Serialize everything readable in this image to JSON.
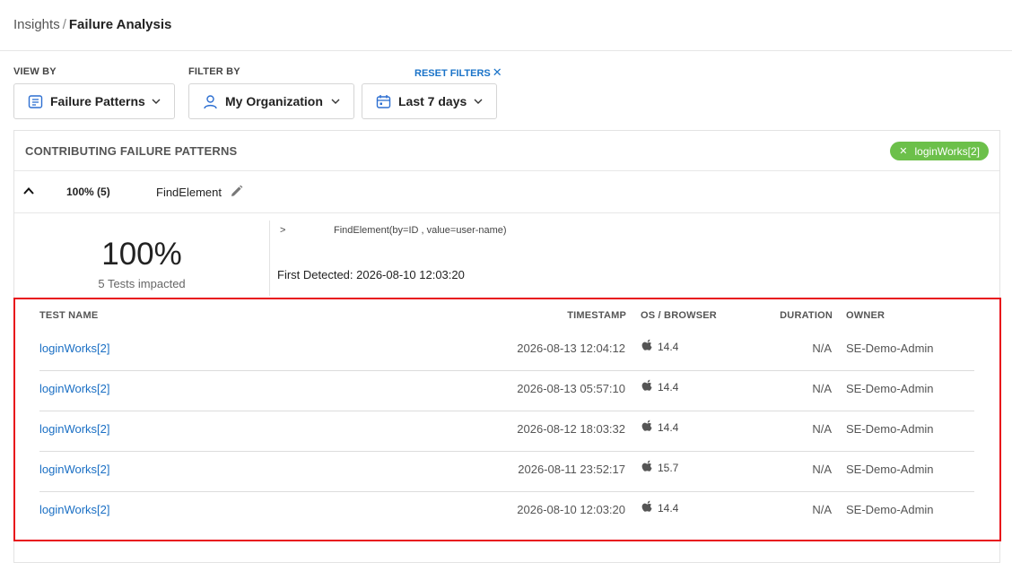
{
  "breadcrumb": {
    "parent": "Insights",
    "separator": "/",
    "current": "Failure Analysis"
  },
  "filters": {
    "view_by_label": "VIEW BY",
    "filter_by_label": "FILTER BY",
    "reset_label": "RESET FILTERS",
    "reset_icon": "close-icon",
    "view_by_value": "Failure Patterns",
    "organization_value": "My Organization",
    "date_range_value": "Last 7 days"
  },
  "panel": {
    "title": "CONTRIBUTING FAILURE PATTERNS",
    "chip_label": "loginWorks[2]",
    "chip_color": "#6cc04a"
  },
  "pattern": {
    "percent_count": "100% (5)",
    "name": "FindElement",
    "percent": "100%",
    "impacted": "5 Tests impacted",
    "prompt": ">",
    "signature": "FindElement(by=ID , value=user-name)",
    "first_detected": "First Detected: 2026-08-10 12:03:20"
  },
  "table": {
    "headers": {
      "test_name": "TEST NAME",
      "timestamp": "TIMESTAMP",
      "os_browser": "OS / BROWSER",
      "duration": "DURATION",
      "owner": "OWNER"
    },
    "rows": [
      {
        "name": "loginWorks[2]",
        "timestamp": "2026-08-13 12:04:12",
        "os_icon": "apple-icon",
        "os_version": "14.4",
        "duration": "N/A",
        "owner": "SE-Demo-Admin"
      },
      {
        "name": "loginWorks[2]",
        "timestamp": "2026-08-13 05:57:10",
        "os_icon": "apple-icon",
        "os_version": "14.4",
        "duration": "N/A",
        "owner": "SE-Demo-Admin"
      },
      {
        "name": "loginWorks[2]",
        "timestamp": "2026-08-12 18:03:32",
        "os_icon": "apple-icon",
        "os_version": "14.4",
        "duration": "N/A",
        "owner": "SE-Demo-Admin"
      },
      {
        "name": "loginWorks[2]",
        "timestamp": "2026-08-11 23:52:17",
        "os_icon": "apple-icon",
        "os_version": "15.7",
        "duration": "N/A",
        "owner": "SE-Demo-Admin"
      },
      {
        "name": "loginWorks[2]",
        "timestamp": "2026-08-10 12:03:20",
        "os_icon": "apple-icon",
        "os_version": "14.4",
        "duration": "N/A",
        "owner": "SE-Demo-Admin"
      }
    ]
  },
  "colors": {
    "link": "#1a6fc4",
    "accent": "#1a73c8",
    "highlight": "#e8101a"
  }
}
